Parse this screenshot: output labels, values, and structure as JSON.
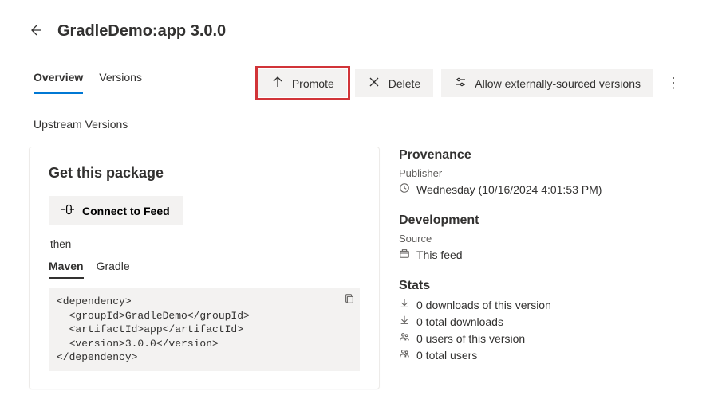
{
  "header": {
    "title": "GradleDemo:app 3.0.0"
  },
  "tabs": {
    "overview": "Overview",
    "versions": "Versions"
  },
  "actions": {
    "promote": "Promote",
    "delete": "Delete",
    "allow_external": "Allow externally-sourced versions"
  },
  "upstream_label": "Upstream Versions",
  "card": {
    "title": "Get this package",
    "connect": "Connect to Feed",
    "then": "then",
    "subtabs": {
      "maven": "Maven",
      "gradle": "Gradle"
    },
    "snippet": "<dependency>\n  <groupId>GradleDemo</groupId>\n  <artifactId>app</artifactId>\n  <version>3.0.0</version>\n</dependency>"
  },
  "provenance": {
    "title": "Provenance",
    "publisher_label": "Publisher",
    "timestamp": "Wednesday (10/16/2024 4:01:53 PM)"
  },
  "development": {
    "title": "Development",
    "source_label": "Source",
    "source_value": "This feed"
  },
  "stats": {
    "title": "Stats",
    "downloads_version": "0 downloads of this version",
    "downloads_total": "0 total downloads",
    "users_version": "0 users of this version",
    "users_total": "0 total users"
  }
}
